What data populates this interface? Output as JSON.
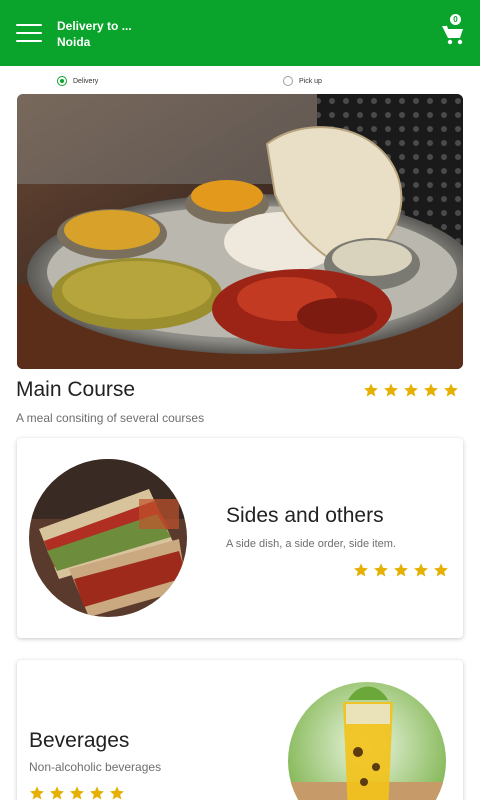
{
  "header": {
    "delivery_label": "Delivery to ...",
    "location": "Noida",
    "cart_count": "0",
    "menu_icon": "hamburger-menu-icon",
    "cart_icon": "shopping-cart-icon"
  },
  "order_mode": {
    "options": [
      "Delivery",
      "Pick up"
    ],
    "selected": "Delivery"
  },
  "featured": {
    "title": "Main Course",
    "description": "A meal consiting of several courses",
    "rating": 5
  },
  "categories": [
    {
      "title": "Sides and others",
      "description": "A side dish, a side order, side item.",
      "rating": 5
    },
    {
      "title": "Beverages",
      "description": "Non-alcoholic beverages",
      "rating": 5
    }
  ],
  "colors": {
    "primary": "#0aa42c",
    "star": "#e6b000"
  }
}
